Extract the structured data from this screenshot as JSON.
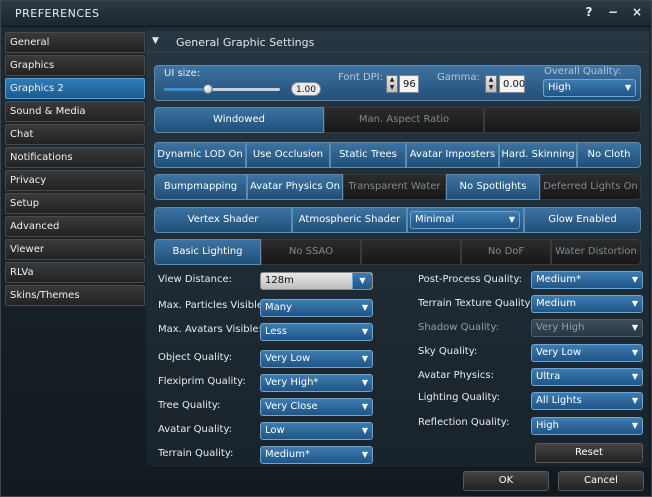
{
  "window": {
    "title": "PREFERENCES",
    "icons": [
      "?",
      "−",
      "×"
    ]
  },
  "sidebar": {
    "items": [
      {
        "label": "General",
        "active": false
      },
      {
        "label": "Graphics",
        "active": false
      },
      {
        "label": "Graphics 2",
        "active": true
      },
      {
        "label": "Sound & Media",
        "active": false
      },
      {
        "label": "Chat",
        "active": false
      },
      {
        "label": "Notifications",
        "active": false
      },
      {
        "label": "Privacy",
        "active": false
      },
      {
        "label": "Setup",
        "active": false
      },
      {
        "label": "Advanced",
        "active": false
      },
      {
        "label": "Viewer",
        "active": false
      },
      {
        "label": "RLVa",
        "active": false
      },
      {
        "label": "Skins/Themes",
        "active": false
      }
    ]
  },
  "panel": {
    "header": "General Graphic Settings",
    "chevron": "▼"
  },
  "top_row": {
    "ui_size_label": "UI size:",
    "ui_size_value": "1.00",
    "ui_size_fraction": 0.38,
    "font_dpi_label": "Font DPI:",
    "font_dpi_value": "96",
    "gamma_label": "Gamma:",
    "gamma_value": "0.00",
    "overall_quality_label": "Overall Quality:",
    "overall_quality_value": "High"
  },
  "row_window": {
    "windowed": "Windowed",
    "aspect": "Man. Aspect Ratio"
  },
  "row_lod": {
    "dynamic_lod": "Dynamic LOD On",
    "occlusion": "Use Occlusion",
    "static_trees": "Static Trees",
    "imposters": "Avatar Imposters",
    "skinning": "Hard. Skinning",
    "cloth": "No Cloth"
  },
  "row_bump": {
    "bump": "Bumpmapping",
    "avatar_physics": "Avatar Physics On",
    "water": "Transparent Water",
    "spotlights": "No Spotlights",
    "deferred": "Deferred Lights On"
  },
  "row_shader": {
    "vertex": "Vertex Shader",
    "atmo": "Atmospheric Shader",
    "atmo_level": "Minimal",
    "glow": "Glow Enabled"
  },
  "row_lighting": {
    "basic": "Basic Lighting",
    "ssao": "No SSAO",
    "dof": "No DoF",
    "distortion": "Water Distortion"
  },
  "left_settings": [
    {
      "label": "View Distance:",
      "value": "128m"
    },
    {
      "label": "Max. Particles Visible:",
      "value": "Many"
    },
    {
      "label": "Max. Avatars Visible:",
      "value": "Less"
    },
    {
      "label": "Object Quality:",
      "value": "Very Low"
    },
    {
      "label": "Flexiprim Quality:",
      "value": "Very High*"
    },
    {
      "label": "Tree Quality:",
      "value": "Very Close"
    },
    {
      "label": "Avatar Quality:",
      "value": "Low"
    },
    {
      "label": "Terrain Quality:",
      "value": "Medium*"
    }
  ],
  "right_settings": [
    {
      "label": "Post-Process Quality:",
      "value": "Medium*"
    },
    {
      "label": "Terrain Texture Quality:",
      "value": "Medium"
    },
    {
      "label": "Shadow Quality:",
      "value": "Very High"
    },
    {
      "label": "Sky Quality:",
      "value": "Very Low"
    },
    {
      "label": "Avatar Physics:",
      "value": "Ultra"
    },
    {
      "label": "Lighting Quality:",
      "value": "All Lights"
    },
    {
      "label": "Reflection Quality:",
      "value": "High"
    }
  ],
  "buttons": {
    "reset": "Reset",
    "ok": "OK",
    "cancel": "Cancel"
  }
}
